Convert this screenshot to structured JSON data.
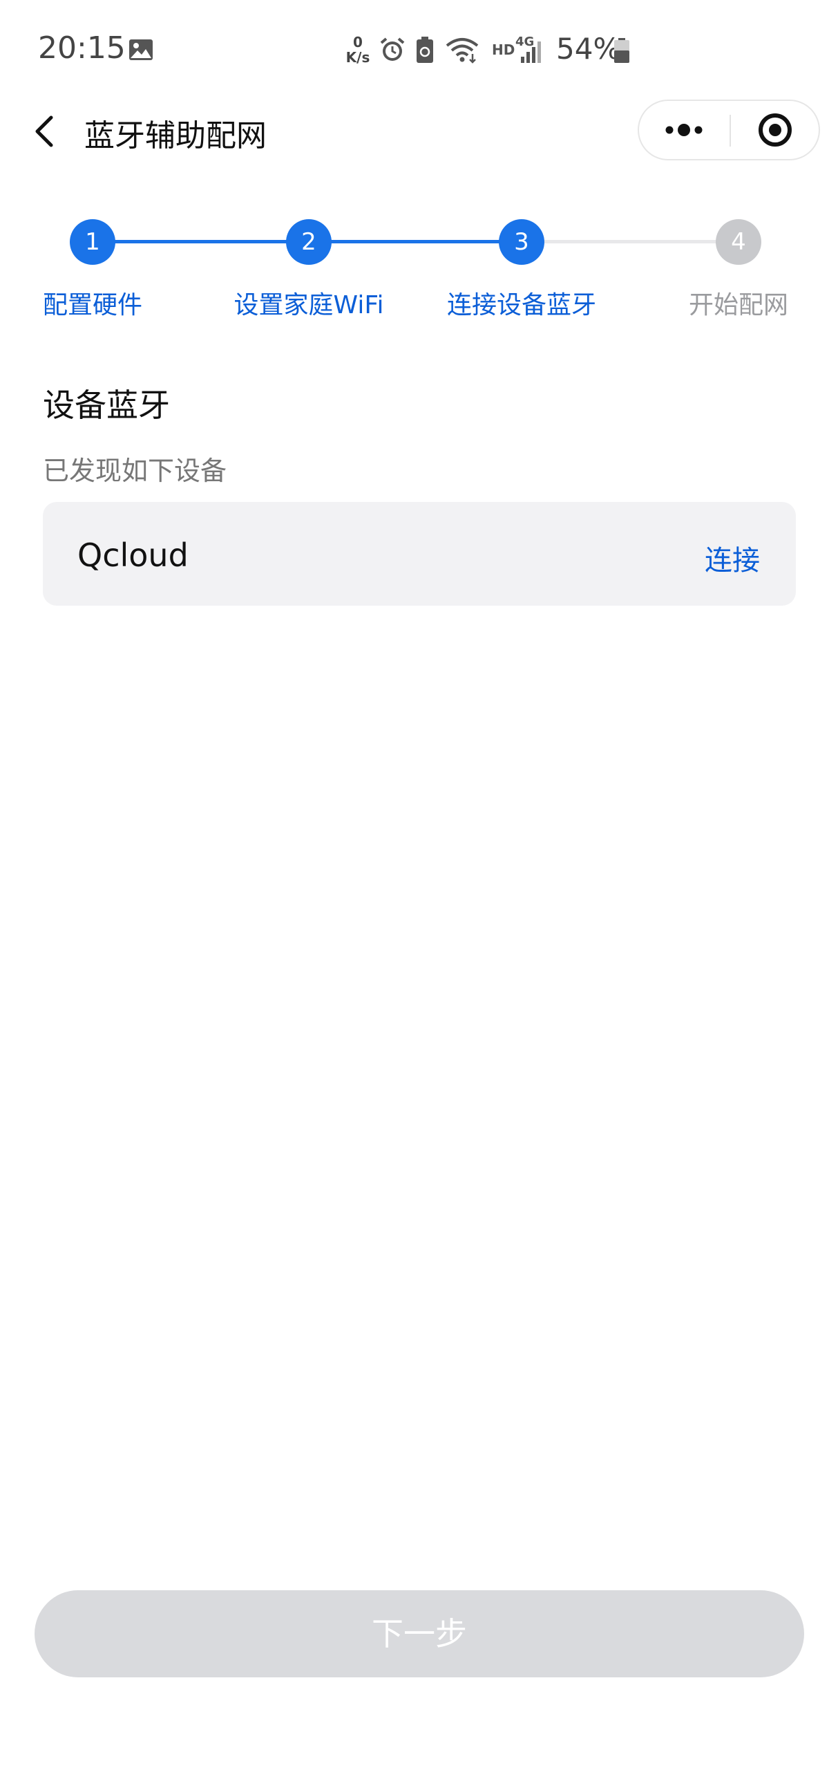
{
  "status_bar": {
    "time": "20:15",
    "net_speed_value": "0",
    "net_speed_unit": "K/s",
    "network_label": "HD",
    "network_type": "4G",
    "battery_percent": "54%",
    "icons": [
      "image-icon",
      "alarm-icon",
      "battery-saver-icon",
      "wifi-icon",
      "signal-icon",
      "battery-icon"
    ]
  },
  "navbar": {
    "title": "蓝牙辅助配网",
    "back_icon": "chevron-left-icon",
    "more_icon": "more-dots-icon",
    "close_icon": "target-close-icon"
  },
  "stepper": {
    "current_step": 3,
    "active_color": "#1a73e8",
    "inactive_color": "#c8c9cc",
    "steps": [
      {
        "number": "1",
        "label": "配置硬件",
        "state": "done"
      },
      {
        "number": "2",
        "label": "设置家庭WiFi",
        "state": "done"
      },
      {
        "number": "3",
        "label": "连接设备蓝牙",
        "state": "active"
      },
      {
        "number": "4",
        "label": "开始配网",
        "state": "pending"
      }
    ]
  },
  "content": {
    "section_title": "设备蓝牙",
    "section_subtitle": "已发现如下设备",
    "devices": [
      {
        "name": "Qcloud",
        "action_label": "连接"
      }
    ]
  },
  "footer": {
    "next_label": "下一步",
    "next_enabled": false
  },
  "colors": {
    "accent": "#1a73e8",
    "link": "#0b5ed7",
    "card_bg": "#f2f2f4",
    "disabled_button": "#d9dadd"
  }
}
